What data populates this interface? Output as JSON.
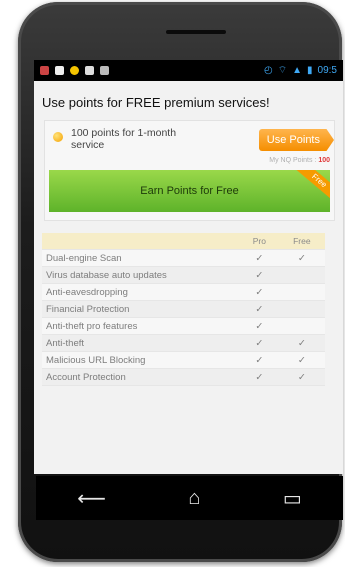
{
  "status": {
    "time": "09:5"
  },
  "heading": "Use points for FREE premium services!",
  "points_offer": {
    "text": "100 points for 1-month service",
    "button": "Use Points"
  },
  "my_points": {
    "label": "My NQ Points :",
    "value": "100"
  },
  "earn": {
    "label": "Earn Points for Free",
    "ribbon": "Free"
  },
  "table": {
    "headers": [
      "",
      "Pro",
      "Free"
    ],
    "rows": [
      {
        "feature": "Dual-engine Scan",
        "pro": "✓",
        "free": "✓"
      },
      {
        "feature": "Virus database auto updates",
        "pro": "✓",
        "free": ""
      },
      {
        "feature": "Anti-eavesdropping",
        "pro": "✓",
        "free": ""
      },
      {
        "feature": "Financial Protection",
        "pro": "✓",
        "free": ""
      },
      {
        "feature": "Anti-theft pro features",
        "pro": "✓",
        "free": ""
      },
      {
        "feature": "Anti-theft",
        "pro": "✓",
        "free": "✓"
      },
      {
        "feature": "Malicious URL Blocking",
        "pro": "✓",
        "free": "✓"
      },
      {
        "feature": "Account Protection",
        "pro": "✓",
        "free": "✓"
      }
    ]
  },
  "nav": {
    "back": "back-icon",
    "home": "home-icon",
    "recent": "recent-apps-icon"
  },
  "colors": {
    "accent_orange": "#f58e00",
    "accent_green": "#5eb32a"
  }
}
